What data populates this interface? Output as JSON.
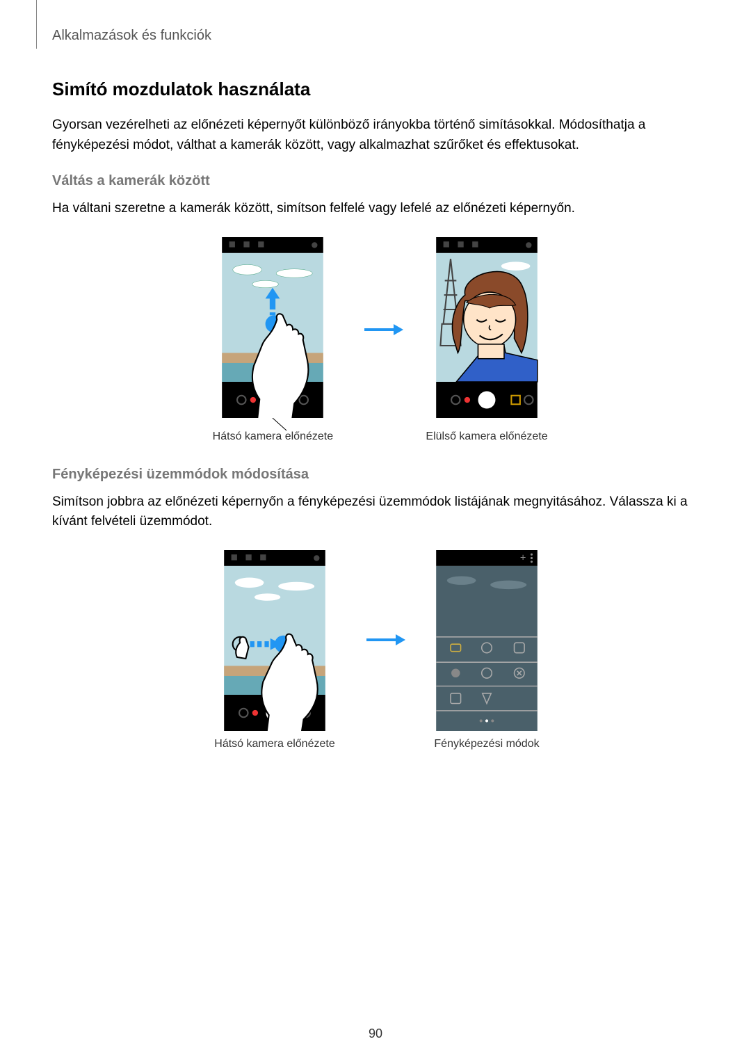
{
  "header": "Alkalmazások és funkciók",
  "title": "Simító mozdulatok használata",
  "intro": "Gyorsan vezérelheti az előnézeti képernyőt különböző irányokba történő simításokkal. Módosíthatja a fényképezési módot, válthat a kamerák között, vagy alkalmazhat szűrőket és effektusokat.",
  "sub1_title": "Váltás a kamerák között",
  "sub1_text": "Ha váltani szeretne a kamerák között, simítson felfelé vagy lefelé az előnézeti képernyőn.",
  "cap1_left": "Hátsó kamera előnézete",
  "cap1_right": "Elülső kamera előnézete",
  "sub2_title": "Fényképezési üzemmódok módosítása",
  "sub2_text": "Simítson jobbra az előnézeti képernyőn a fényképezési üzemmódok listájának megnyitásához. Válassza ki a kívánt felvételi üzemmódot.",
  "cap2_left": "Hátsó kamera előnézete",
  "cap2_right": "Fényképezési módok",
  "page_num": "90"
}
